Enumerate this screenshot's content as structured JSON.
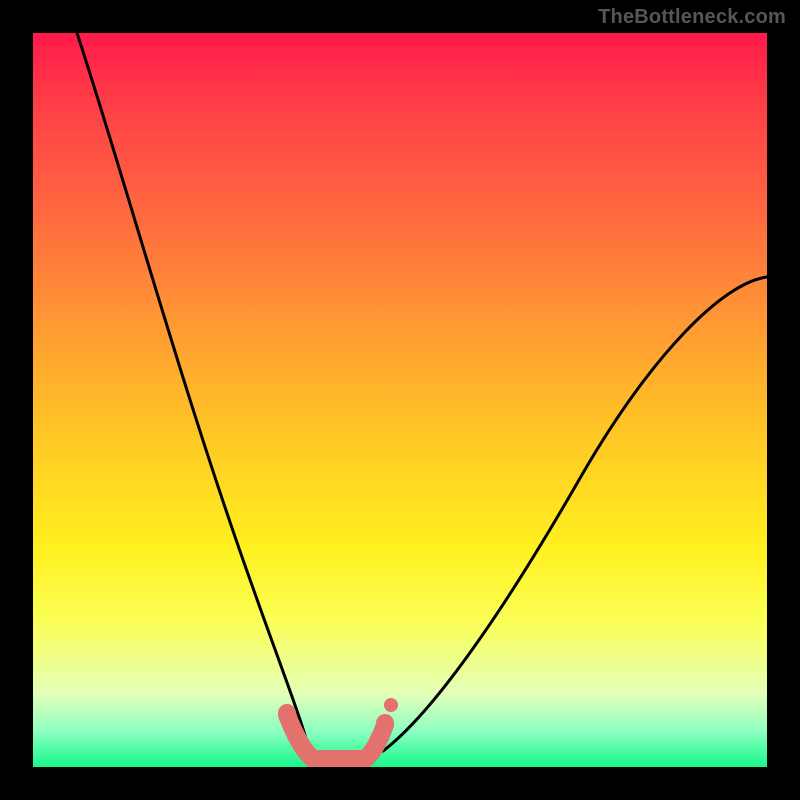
{
  "attribution": "TheBottleneck.com",
  "chart_data": {
    "type": "line",
    "title": "",
    "xlabel": "",
    "ylabel": "",
    "xlim": [
      0,
      100
    ],
    "ylim": [
      0,
      100
    ],
    "gradient_stops": [
      {
        "pos": 0,
        "color": "#ff1a4a"
      },
      {
        "pos": 25,
        "color": "#ff6a3f"
      },
      {
        "pos": 55,
        "color": "#ffc824"
      },
      {
        "pos": 80,
        "color": "#fbff55"
      },
      {
        "pos": 100,
        "color": "#16f88a"
      }
    ],
    "series": [
      {
        "name": "left-curve",
        "color": "#000000",
        "x": [
          0,
          4,
          8,
          12,
          16,
          20,
          24,
          28,
          32,
          35,
          37
        ],
        "y": [
          100,
          87,
          74,
          62,
          50,
          39,
          29,
          20,
          12,
          5,
          1
        ]
      },
      {
        "name": "right-curve",
        "color": "#000000",
        "x": [
          47,
          50,
          55,
          60,
          66,
          73,
          80,
          88,
          96,
          100
        ],
        "y": [
          1,
          4,
          9,
          15,
          23,
          32,
          42,
          52,
          62,
          66
        ]
      },
      {
        "name": "valley-marker",
        "color": "#e86a6a",
        "x": [
          34,
          36,
          37,
          38,
          40,
          42,
          44,
          45,
          46,
          48
        ],
        "y": [
          6,
          3,
          1,
          0,
          0,
          0,
          0,
          1,
          3,
          6
        ]
      }
    ]
  }
}
